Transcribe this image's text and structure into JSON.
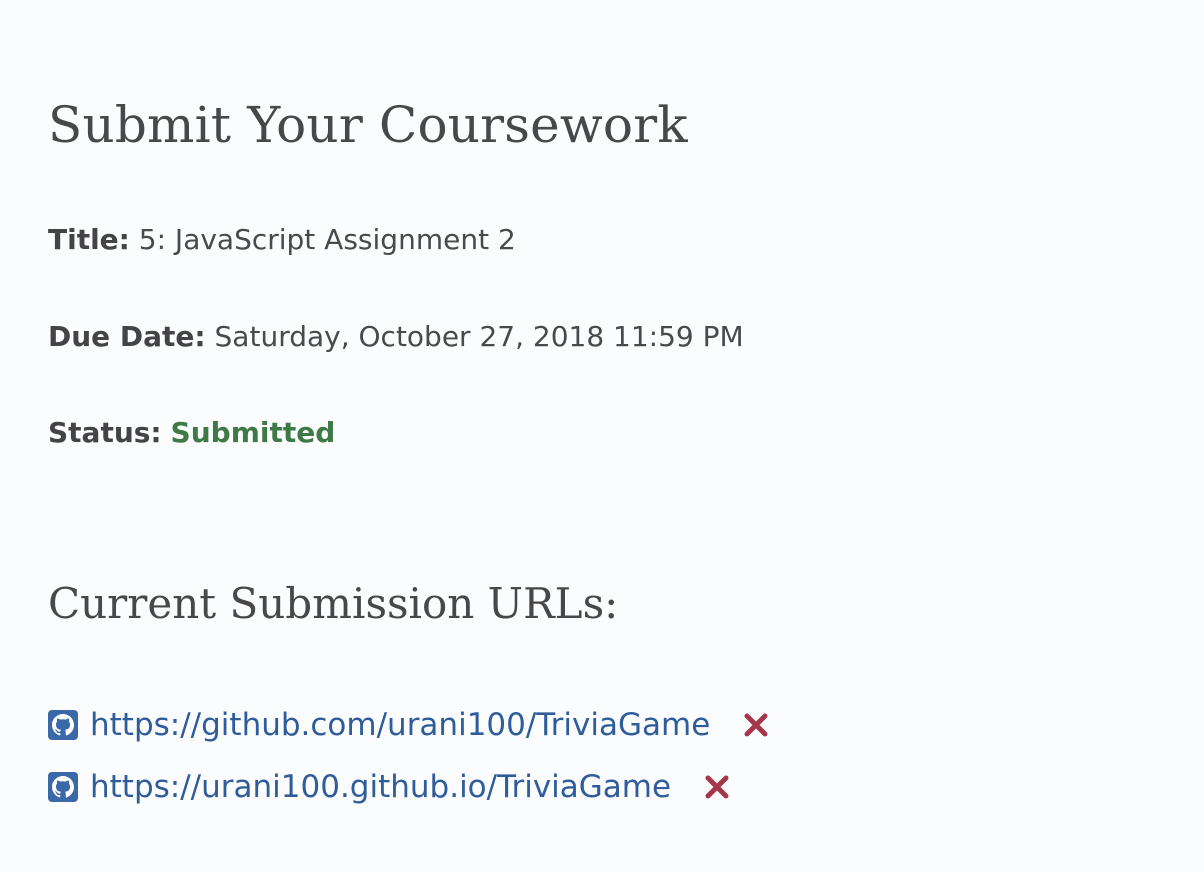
{
  "page": {
    "title": "Submit Your Coursework"
  },
  "assignment": {
    "title_label": "Title:",
    "title_value": "5: JavaScript Assignment 2",
    "due_label": "Due Date:",
    "due_value": "Saturday, October 27, 2018 11:59 PM",
    "status_label": "Status:",
    "status_value": "Submitted"
  },
  "submissions": {
    "heading": "Current Submission URLs:",
    "urls": [
      {
        "text": "https://github.com/urani100/TriviaGame",
        "icon": "github-icon",
        "remove_icon": "remove-icon"
      },
      {
        "text": "https://urani100.github.io/TriviaGame",
        "icon": "github-icon",
        "remove_icon": "remove-icon"
      }
    ]
  },
  "colors": {
    "background": "#fbfcfe",
    "text": "#454547",
    "status_ok": "#3f7a46",
    "link": "#2f5d9b",
    "icon": "#3b68a8",
    "remove": "#a5374a"
  }
}
